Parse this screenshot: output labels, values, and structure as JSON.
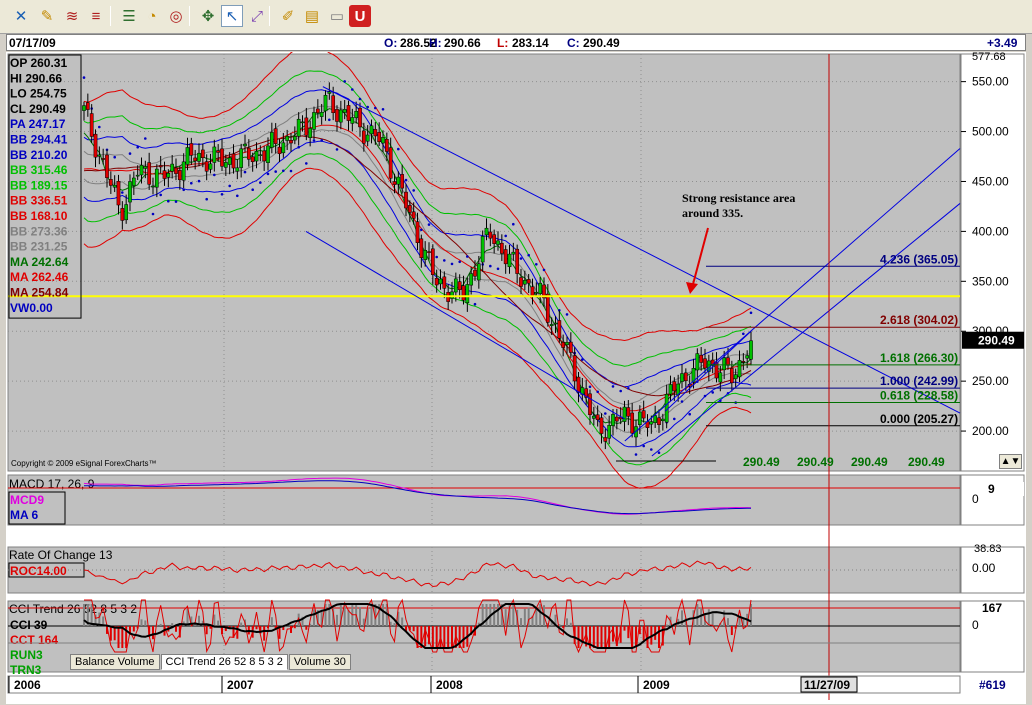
{
  "toolbar": {
    "buttons": [
      {
        "name": "crosshair-icon",
        "glyph": "✕",
        "color": "#1a5fb4"
      },
      {
        "name": "pencil-icon",
        "glyph": "✎",
        "color": "#c48a00"
      },
      {
        "name": "fib-lines-icon",
        "glyph": "≋",
        "color": "#b02020"
      },
      {
        "name": "horizontal-lines-icon",
        "glyph": "≡",
        "color": "#b02020"
      },
      {
        "name": "properties-icon",
        "glyph": "☰",
        "color": "#2f6f2f"
      },
      {
        "name": "clock-icon",
        "glyph": "◔",
        "color": "#c48a00"
      },
      {
        "name": "target-icon",
        "glyph": "◎",
        "color": "#b02020"
      },
      {
        "name": "move-icon",
        "glyph": "✥",
        "color": "#2f6f2f"
      },
      {
        "name": "cursor-icon",
        "glyph": "↖",
        "color": "#1a5fb4"
      },
      {
        "name": "zoom-cursor-icon",
        "glyph": "⤢",
        "color": "#7a3fb0"
      },
      {
        "name": "highlighter-icon",
        "glyph": "✐",
        "color": "#c48a00"
      },
      {
        "name": "note-icon",
        "glyph": "▤",
        "color": "#c48a00"
      },
      {
        "name": "speech-bubble-icon",
        "glyph": "▭",
        "color": "#808080"
      },
      {
        "name": "magnet-icon",
        "glyph": "U",
        "color": "#ffffff"
      }
    ]
  },
  "quote": {
    "date": "07/17/09",
    "open_label": "O:",
    "open": "286.52",
    "high_label": "H:",
    "high": "290.66",
    "low_label": "L:",
    "low": "283.14",
    "close_label": "C:",
    "close": "290.49",
    "change": "+3.49"
  },
  "price_panel": {
    "legend": [
      {
        "text": "OP 260.31",
        "color": "#000000"
      },
      {
        "text": "HI  290.66",
        "color": "#000000"
      },
      {
        "text": "LO  254.75",
        "color": "#000000"
      },
      {
        "text": "CL  290.49",
        "color": "#000000"
      },
      {
        "text": "PA  247.17",
        "color": "#0000c0"
      },
      {
        "text": "BB  294.41",
        "color": "#0000c0"
      },
      {
        "text": "BB  210.20",
        "color": "#0000c0"
      },
      {
        "text": "BB  315.46",
        "color": "#00c000"
      },
      {
        "text": "BB  189.15",
        "color": "#00c000"
      },
      {
        "text": "BB  336.51",
        "color": "#e00000"
      },
      {
        "text": "BB  168.10",
        "color": "#e00000"
      },
      {
        "text": "BB  273.36",
        "color": "#808080"
      },
      {
        "text": "BB  231.25",
        "color": "#808080"
      },
      {
        "text": "MA 242.64",
        "color": "#007000"
      },
      {
        "text": "MA 262.46",
        "color": "#e00000"
      },
      {
        "text": "MA 254.84",
        "color": "#800000"
      },
      {
        "text": "VW0.00",
        "color": "#0000c0"
      }
    ],
    "annotation": [
      "Strong resistance area",
      "around 335."
    ],
    "resistance_level": 335,
    "fib_levels": [
      {
        "label": "4.236 (365.05)",
        "value": 365.05,
        "color": "#000080"
      },
      {
        "label": "2.618 (304.02)",
        "value": 304.02,
        "color": "#800000"
      },
      {
        "label": "1.618 (266.30)",
        "value": 266.3,
        "color": "#007000"
      },
      {
        "label": "1.000 (242.99)",
        "value": 242.99,
        "color": "#000080"
      },
      {
        "label": "0.618 (228.58)",
        "value": 228.58,
        "color": "#007000"
      },
      {
        "label": "0.000 (205.27)",
        "value": 205.27,
        "color": "#000000"
      }
    ],
    "bottom_values": [
      "290.49",
      "290.49",
      "290.49",
      "290.49"
    ],
    "last_price": "290.49",
    "copyright": "Copyright © 2009 eSignal ForexCharts™",
    "axis_ticks": [
      "550.00",
      "500.00",
      "450.00",
      "400.00",
      "350.00",
      "300.00",
      "250.00",
      "200.00"
    ],
    "axis_top": "577.68"
  },
  "macd_panel": {
    "title": "MACD 17, 26, 9",
    "legend": [
      {
        "text": "MCD9",
        "color": "#e000e0"
      },
      {
        "text": "MA   6",
        "color": "#0000c0"
      }
    ],
    "axis": [
      "9",
      "0"
    ]
  },
  "roc_panel": {
    "title": "Rate Of Change 13",
    "legend": "ROC14.00",
    "axis": [
      "38.83",
      "0.00"
    ]
  },
  "cci_panel": {
    "title": "CCI Trend 26 52 8 5 3 2",
    "legend": [
      {
        "text": "CCI  39",
        "color": "#000000"
      },
      {
        "text": "CCT 164",
        "color": "#e00000"
      },
      {
        "text": "RUN3",
        "color": "#00a000"
      },
      {
        "text": "TRN3",
        "color": "#00a000"
      }
    ],
    "axis": [
      "167",
      "0"
    ]
  },
  "tabs": [
    "Balance Volume",
    "CCI Trend 26 52 8 5 3 2",
    "Volume 30"
  ],
  "active_tab": 1,
  "x_axis": {
    "labels": [
      "2006",
      "2007",
      "2008",
      "2009"
    ],
    "cursor_date": "11/27/09",
    "bar_count": "#619"
  },
  "colors": {
    "plot_bg": "#c0c0c0",
    "up_candle": "#00c000",
    "down_candle": "#e00000",
    "bb_outer": "#e00000",
    "bb_mid": "#00c000",
    "bb_inner": "#0000e0",
    "resistance": "#ffff00",
    "cursor_line": "#c00000"
  },
  "chart_data": {
    "type": "candlestick",
    "ylim": [
      160,
      577.68
    ],
    "resistance": 335,
    "close_path": [
      {
        "t": 0.0,
        "c": 520
      },
      {
        "t": 0.02,
        "c": 470
      },
      {
        "t": 0.04,
        "c": 420
      },
      {
        "t": 0.06,
        "c": 460
      },
      {
        "t": 0.09,
        "c": 455
      },
      {
        "t": 0.12,
        "c": 475
      },
      {
        "t": 0.16,
        "c": 470
      },
      {
        "t": 0.2,
        "c": 480
      },
      {
        "t": 0.24,
        "c": 500
      },
      {
        "t": 0.27,
        "c": 530
      },
      {
        "t": 0.3,
        "c": 510
      },
      {
        "t": 0.33,
        "c": 490
      },
      {
        "t": 0.36,
        "c": 420
      },
      {
        "t": 0.39,
        "c": 350
      },
      {
        "t": 0.42,
        "c": 335
      },
      {
        "t": 0.45,
        "c": 400
      },
      {
        "t": 0.48,
        "c": 360
      },
      {
        "t": 0.51,
        "c": 330
      },
      {
        "t": 0.54,
        "c": 270
      },
      {
        "t": 0.57,
        "c": 200
      },
      {
        "t": 0.6,
        "c": 215
      },
      {
        "t": 0.63,
        "c": 205
      },
      {
        "t": 0.66,
        "c": 250
      },
      {
        "t": 0.69,
        "c": 270
      },
      {
        "t": 0.72,
        "c": 255
      },
      {
        "t": 0.74,
        "c": 290.49
      }
    ]
  }
}
